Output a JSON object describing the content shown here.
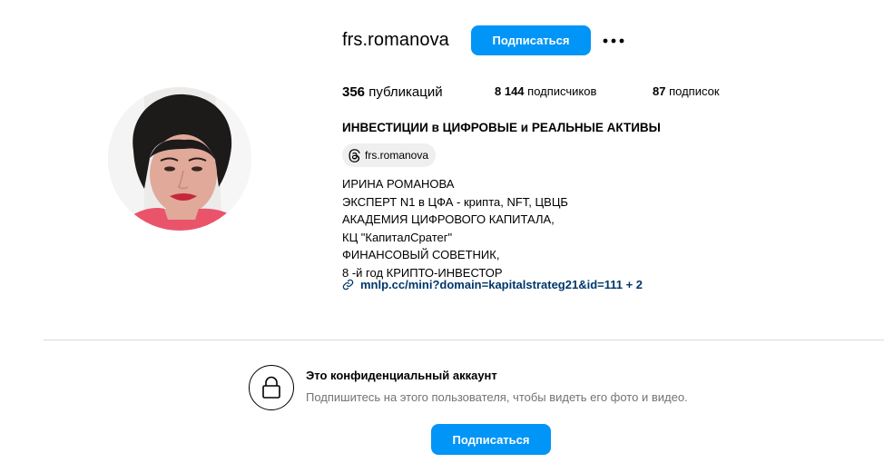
{
  "profile": {
    "username": "frs.romanova",
    "follow_label": "Подписаться",
    "more_icon": "more-horizontal-icon",
    "avatar_icon": "profile-photo"
  },
  "stats": {
    "posts_count": "356",
    "posts_label": "публикаций",
    "followers_count": "8 144",
    "followers_label": "подписчиков",
    "following_count": "87",
    "following_label": "подписок"
  },
  "bio": {
    "title": "ИНВЕСТИЦИИ в ЦИФРОВЫЕ и РЕАЛЬНЫЕ АКТИВЫ",
    "threads_handle": "frs.romanova",
    "threads_icon": "threads-icon",
    "lines": [
      "ИРИНА РОМАНОВА",
      "ЭКСПЕРТ N1 в ЦФА - крипта, NFT, ЦВЦБ",
      "АКАДЕМИЯ ЦИФРОВОГО КАПИТАЛА,",
      "КЦ \"КапиталСратег\"",
      "ФИНАНСОВЫЙ СОВЕТНИК,",
      "8 -й год КРИПТО-ИНВЕСТОР"
    ],
    "link_icon": "link-icon",
    "link_text": "mnlp.cc/mini?domain=kapitalstrateg21&id=111 + 2",
    "link_color": "#00376b"
  },
  "private": {
    "lock_icon": "lock-icon",
    "title": "Это конфиденциальный аккаунт",
    "subtitle": "Подпишитесь на этого пользователя, чтобы видеть его фото и видео.",
    "follow_label": "Подписаться"
  },
  "colors": {
    "accent": "#0095f6",
    "muted_text": "#737373",
    "divider": "#dbdbdb",
    "chip_bg": "#efefef"
  }
}
